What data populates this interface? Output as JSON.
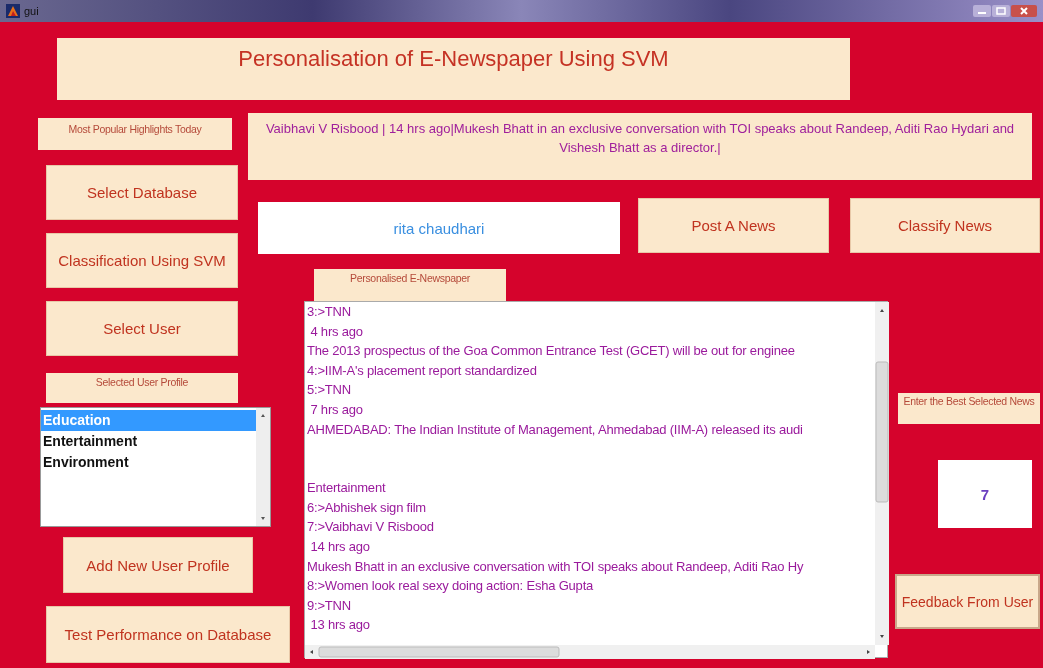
{
  "window": {
    "title": "gui"
  },
  "title": "Personalisation of E-Newspaper Using SVM",
  "highlights_label": "Most Popular Highlights Today",
  "headline": "Vaibhavi V Risbood | 14 hrs ago|Mukesh Bhatt in an exclusive conversation with TOI speaks about Randeep, Aditi Rao Hydari and Vishesh Bhatt as a director.|",
  "left_buttons": [
    "Select Database",
    "Classification Using SVM",
    "Select User"
  ],
  "profile_label": "Selected User Profile",
  "profile_list": [
    {
      "label": "Education",
      "selected": true
    },
    {
      "label": "Entertainment",
      "selected": false
    },
    {
      "label": "Environment",
      "selected": false
    }
  ],
  "add_profile_button": "Add New User Profile",
  "test_button": "Test Performance on Database",
  "user_field": {
    "value": "rita chaudhari"
  },
  "post_button": "Post A  News",
  "classify_button": "Classify News",
  "newspaper_label": "Personalised E-Newspaper",
  "newspaper_groups": [
    [
      "3:>TNN",
      " 4 hrs ago",
      "The 2013 prospectus of the Goa Common Entrance Test (GCET) will be out for enginee",
      "4:>IIM-A's placement report standardized",
      "5:>TNN",
      " 7 hrs ago",
      "AHMEDABAD: The Indian Institute of Management, Ahmedabad (IIM-A) released its audi"
    ],
    [
      "Entertainment",
      "6:>Abhishek sign film",
      "7:>Vaibhavi V Risbood",
      " 14 hrs ago",
      "Mukesh Bhatt in an exclusive conversation with TOI speaks about Randeep, Aditi Rao Hy",
      "8:>Women look real sexy doing action: Esha Gupta",
      "9:>TNN",
      " 13 hrs ago"
    ]
  ],
  "best_news_label": "Enter the Best Selected News",
  "best_news_field": {
    "value": "7"
  },
  "feedback_button": "Feedback From User"
}
